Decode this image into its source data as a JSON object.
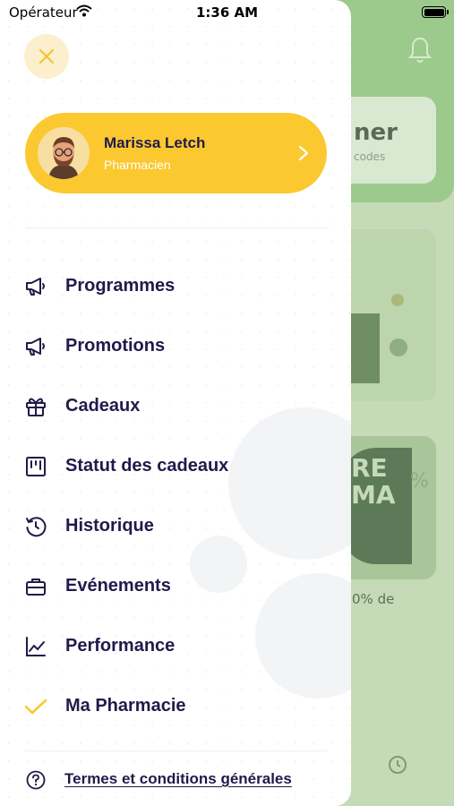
{
  "status_bar": {
    "carrier": "Opérateur",
    "time": "1:36 AM"
  },
  "background": {
    "card1_title": "ner",
    "card1_sub": "codes",
    "card3_tag": "RE MA",
    "card3_pct": "%",
    "card3_text": "0% de"
  },
  "drawer": {
    "close_icon": "close-icon",
    "profile": {
      "name": "Marissa Letch",
      "role": "Pharmacien"
    },
    "menu": [
      {
        "label": "Programmes",
        "icon": "megaphone-icon"
      },
      {
        "label": "Promotions",
        "icon": "megaphone-icon"
      },
      {
        "label": "Cadeaux",
        "icon": "gift-icon"
      },
      {
        "label": "Statut des cadeaux",
        "icon": "status-board-icon"
      },
      {
        "label": "Historique",
        "icon": "history-icon"
      },
      {
        "label": "Evénements",
        "icon": "briefcase-icon"
      },
      {
        "label": "Performance",
        "icon": "chart-icon"
      },
      {
        "label": "Ma Pharmacie",
        "icon": "check-icon"
      }
    ],
    "footer": {
      "label": "Termes et conditions générales",
      "icon": "help-icon"
    }
  },
  "colors": {
    "accent": "#fcc830",
    "text": "#211a4a",
    "close_bg": "#fbefcd",
    "bg_green": "#9cc98c"
  }
}
